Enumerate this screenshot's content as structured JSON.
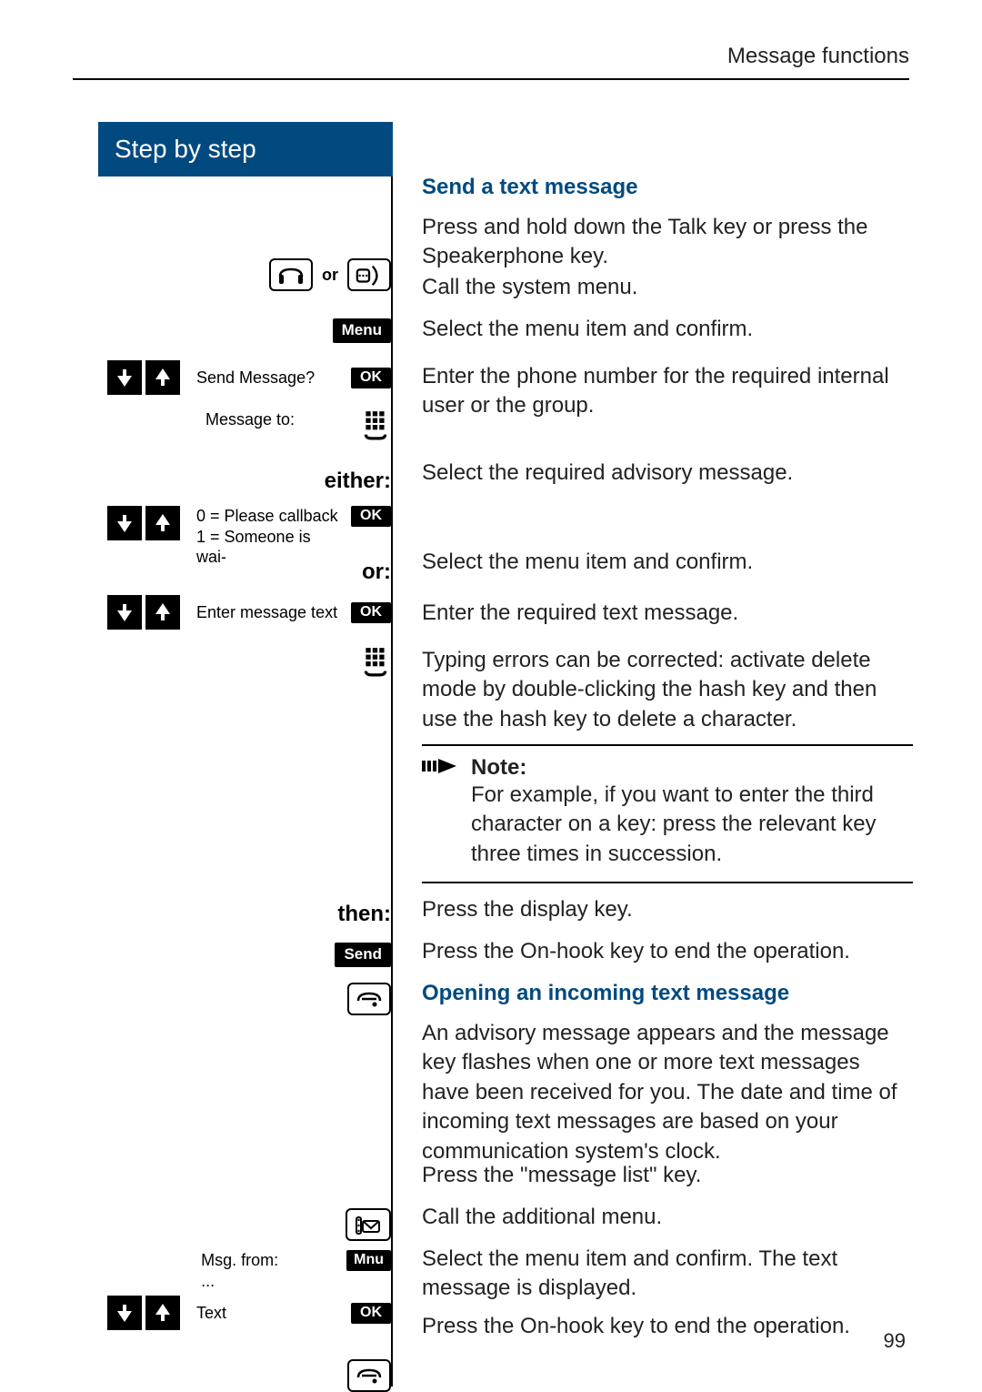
{
  "page": {
    "header_right": "Message functions",
    "number": "99"
  },
  "left": {
    "title": "Step by step",
    "or_text": "or",
    "either": "either:",
    "or2": "or:",
    "then": "then:",
    "menu_label": "Menu",
    "ok_label": "OK",
    "send_label": "Send",
    "mnu_label": "Mnu",
    "send_message_q": "Send Message?",
    "message_to": "Message to:",
    "advisory_list": "0 = Please callback\n1 = Someone is wai-",
    "enter_text": "Enter message text",
    "msg_from": "Msg. from:\n...",
    "text_item": "Text"
  },
  "right": {
    "h1": "Send a text message",
    "r1": "Press and hold down the Talk key or press the Speakerphone key.",
    "r2": "Call the system menu.",
    "r3": "Select the menu item and confirm.",
    "r4": "Enter the phone number for the required internal user or the group.",
    "r5": "Select the required advisory message.",
    "r6": "Select the menu item and confirm.",
    "r7": "Enter the required text message.",
    "r8": "Typing errors can be corrected: activate delete mode by double-clicking the hash key and then use the hash key to delete a character.",
    "note_title": "Note:",
    "note_text": "For example, if you want to enter the third character on a key: press the relevant key three times in succession.",
    "r9": "Press the display key.",
    "r10": "Press the On-hook key to end the operation.",
    "h2": "Opening an incoming text message",
    "r11": "An advisory message appears and the message key flashes when one or more text messages have been received for you. The date and time of incoming text messages are based on your communication system's clock.",
    "r12": "Press the \"message list\" key.",
    "r13": "Call the additional menu.",
    "r14": "Select the menu item and confirm. The text message is displayed.",
    "r15": "Press the On-hook key to end the operation."
  }
}
